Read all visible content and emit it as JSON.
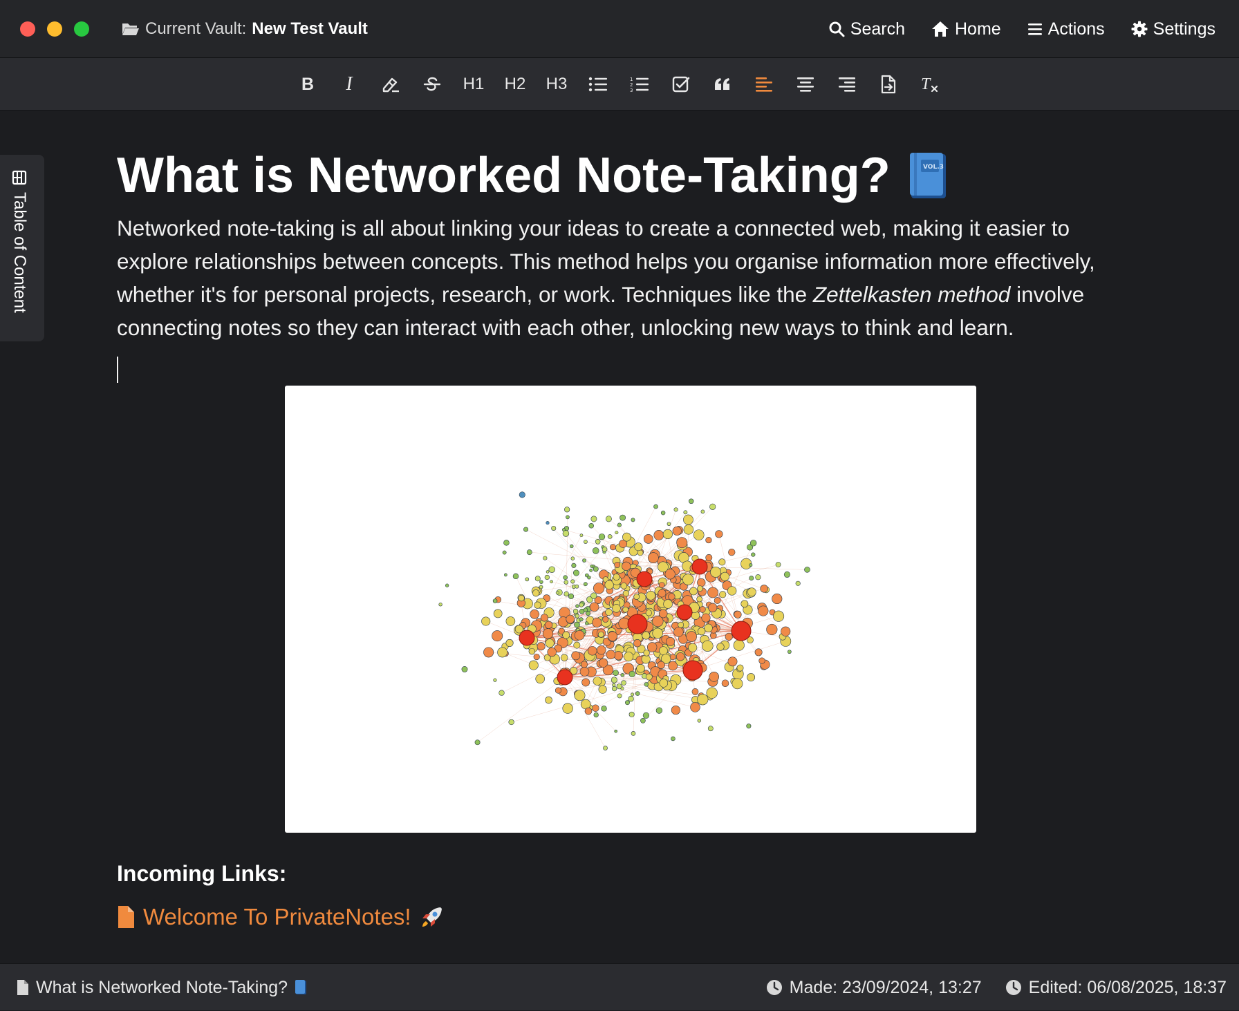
{
  "window": {
    "vault_label": "Current Vault:",
    "vault_name": "New Test Vault"
  },
  "nav": {
    "search": "Search",
    "home": "Home",
    "actions": "Actions",
    "settings": "Settings"
  },
  "toolbar": {
    "items": [
      "bold-icon",
      "italic-icon",
      "highlight-icon",
      "strikethrough-icon",
      "H1",
      "H2",
      "H3",
      "bullet-list-icon",
      "numbered-list-icon",
      "checklist-icon",
      "quote-icon",
      "align-left-icon",
      "align-center-icon",
      "align-right-icon",
      "export-icon",
      "clear-format-icon"
    ],
    "h1": "H1",
    "h2": "H2",
    "h3": "H3",
    "active_item": "align-left-icon",
    "accent_color": "#f08a3e"
  },
  "sidebar": {
    "toc_label": "Table of Content"
  },
  "note": {
    "title": "What is Networked Note-Taking?",
    "title_emoji": "blue-book-icon",
    "paragraph_1": "Networked note-taking is all about linking your ideas to create a connected web, making it easier to explore relationships between concepts. This method helps you organise information more effectively, whether it's for personal projects, research, or work. Techniques like the ",
    "paragraph_em": "Zettelkasten method",
    "paragraph_2": " involve connecting notes so they can interact with each other, unlocking new ways to think and learn.",
    "image": "network-graph-image"
  },
  "links": {
    "heading": "Incoming Links:",
    "items": [
      {
        "label": "Welcome To PrivateNotes!",
        "icon": "file-icon",
        "emoji": "rocket-icon"
      }
    ]
  },
  "status": {
    "file_title": "What is Networked Note-Taking?",
    "made": "Made: 23/09/2024, 13:27",
    "edited": "Edited: 06/08/2025, 18:37"
  }
}
